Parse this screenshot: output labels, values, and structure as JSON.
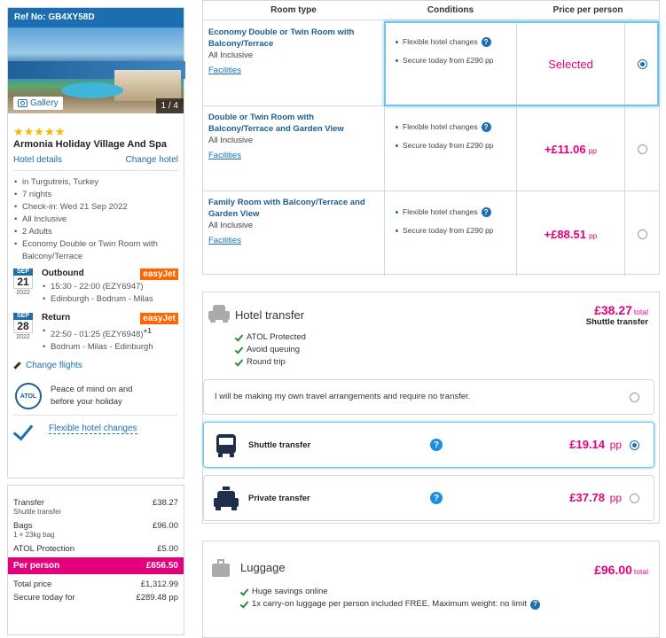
{
  "booking": {
    "ref": "Ref No: GB4XY58D",
    "gallery_label": "Gallery",
    "photo_count": "1 / 4",
    "stars": "★★★★★",
    "hotel_name": "Armonia Holiday Village And Spa",
    "hotel_details_link": "Hotel details",
    "change_hotel_link": "Change hotel",
    "details": [
      "in Turgutreis, Turkey",
      "7 nights",
      "Check-in: Wed 21 Sep 2022",
      "All Inclusive",
      "2 Adults",
      "Economy Double or Twin Room with Balcony/Terrace"
    ]
  },
  "outbound": {
    "month": "SEP",
    "day": "21",
    "year": "2022",
    "title": "Outbound",
    "airline": "easyJet",
    "time": "15:30 - 22:00 (EZY6947)",
    "route": "Edinburgh - Bodrum - Milas"
  },
  "return": {
    "month": "SEP",
    "day": "28",
    "year": "2022",
    "title": "Return",
    "airline": "easyJet",
    "time": "22:50 - 01:25 (EZY6948)",
    "plus": "+1",
    "route": "Bodrum - Milas - Edinburgh"
  },
  "change_flights": "Change flights",
  "atol": {
    "logo": "ATOL",
    "text": "Peace of mind on and before your holiday"
  },
  "flexible_changes": "Flexible hotel changes",
  "summary": {
    "transfer_label": "Transfer",
    "transfer_value": "£38.27",
    "transfer_sub": "Shuttle transfer",
    "bags_label": "Bags",
    "bags_value": "£96.00",
    "bags_sub": "1 × 23kg bag",
    "atol_label": "ATOL Protection",
    "atol_value": "£5.00",
    "per_person_label": "Per person",
    "per_person_value": "£656.50",
    "total_label": "Total price",
    "total_value": "£1,312.99",
    "secure_label": "Secure today for",
    "secure_value": "£289.48 pp"
  },
  "rooms": {
    "headers": [
      "Room type",
      "Conditions",
      "Price per person"
    ],
    "facilities_label": "Facilities",
    "cond1": "Flexible hotel changes",
    "rows": [
      {
        "name": "Economy Double or Twin Room with Balcony/Terrace",
        "board": "All Inclusive",
        "secure": "Secure today from £290 pp",
        "price": "Selected",
        "pp": ""
      },
      {
        "name": "Double or Twin Room with Balcony/Terrace and Garden View",
        "board": "All Inclusive",
        "secure": "Secure today from £290 pp",
        "price": "+£11.06",
        "pp": "pp"
      },
      {
        "name": "Family Room with Balcony/Terrace and Garden View",
        "board": "All Inclusive",
        "secure": "Secure today from £290 pp",
        "price": "+£88.51",
        "pp": "pp"
      }
    ]
  },
  "transfer": {
    "title": "Hotel transfer",
    "price": "£38.27",
    "price_suffix": "total",
    "type": "Shuttle transfer",
    "checks": [
      "ATOL Protected",
      "Avoid queuing",
      "Round trip"
    ],
    "own_arrangements": "I will be making my own travel arrangements and require no transfer.",
    "shuttle_label": "Shuttle transfer",
    "shuttle_price": "£19.14",
    "shuttle_pp": "pp",
    "private_label": "Private transfer",
    "private_price": "£37.78",
    "private_pp": "pp",
    "help": "?"
  },
  "luggage": {
    "title": "Luggage",
    "price": "£96.00",
    "price_suffix": "total",
    "checks": [
      "Huge savings online",
      "1x carry-on luggage per person included FREE. Maximum weight: no limit"
    ],
    "help": "?"
  },
  "colors": {
    "brand_blue": "#1b6fb0",
    "pink": "#e4007c",
    "easyjet": "#ff6600"
  }
}
